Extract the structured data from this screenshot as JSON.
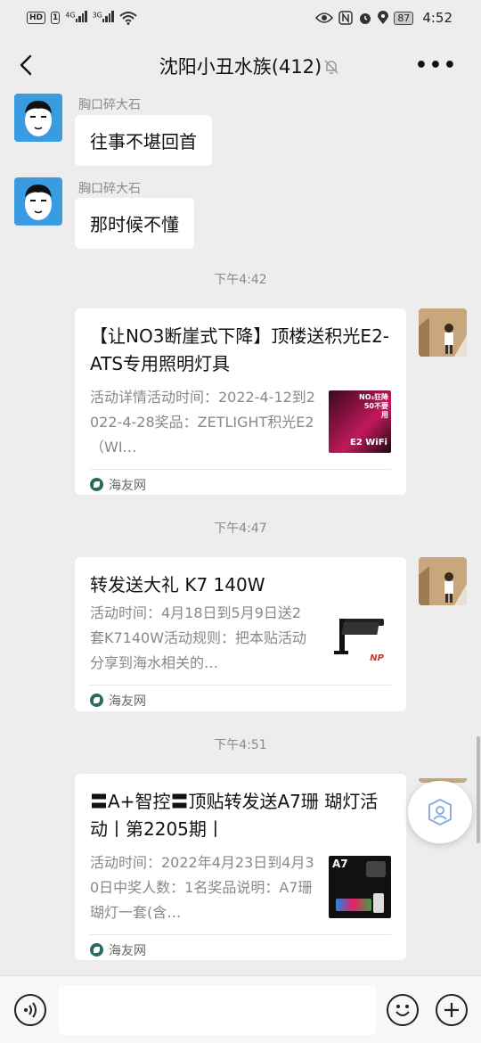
{
  "status_bar": {
    "hd_badge": "HD",
    "sim1": "1",
    "net1": "4G",
    "net2": "3G",
    "battery": "87",
    "time": "4:52"
  },
  "header": {
    "title": "沈阳小丑水族(412)"
  },
  "messages": [
    {
      "sender": "胸口碎大石",
      "text": "往事不堪回首"
    },
    {
      "sender": "胸口碎大石",
      "text": "那时候不懂"
    }
  ],
  "timestamps": [
    "下午4:42",
    "下午4:47",
    "下午4:51"
  ],
  "cards": [
    {
      "title": "【让NO3断崖式下降】顶楼送积光E2-ATS专用照明灯具",
      "desc": "活动详情活动时间：2022-4-12到2022-4-28奖品：ZETLIGHT积光E2（WI…",
      "thumb_text": "NO₃狂降 50不要用",
      "thumb_sub": "E2 WiFi",
      "source": "海友网"
    },
    {
      "title": "转发送大礼 K7 140W",
      "desc": "活动时间：4月18日到5月9日送2套K7140W活动规则：把本贴活动分享到海水相关的…",
      "thumb_text": "NP",
      "source": "海友网"
    },
    {
      "title": "〓A+智控〓顶贴转发送A7珊 瑚灯活动丨第2205期丨",
      "desc": "活动时间：2022年4月23日到4月30日中奖人数：1名奖品说明：A7珊瑚灯一套(含…",
      "thumb_text": "A7",
      "source": "海友网"
    }
  ],
  "colors": {
    "background": "#ededed",
    "bubble": "#ffffff",
    "muted_text": "#8a8a8a"
  }
}
